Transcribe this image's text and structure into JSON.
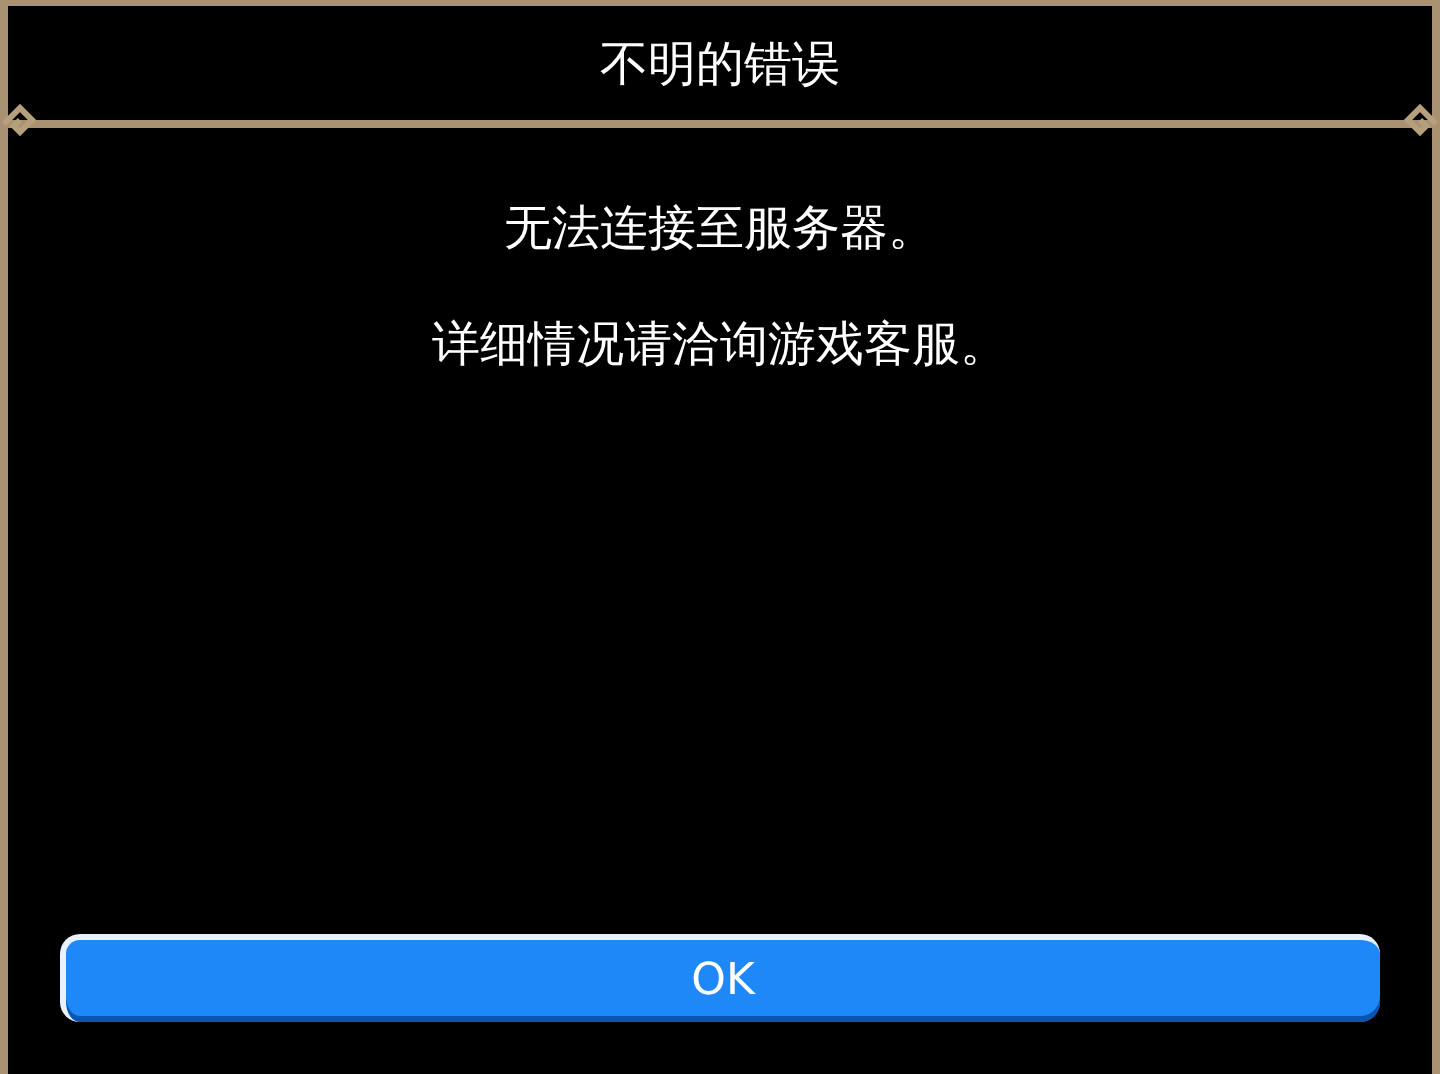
{
  "dialog": {
    "title": "不明的错误",
    "messages": [
      "无法连接至服务器。",
      "详细情况请洽询游戏客服。"
    ],
    "buttons": [
      "OK"
    ]
  }
}
